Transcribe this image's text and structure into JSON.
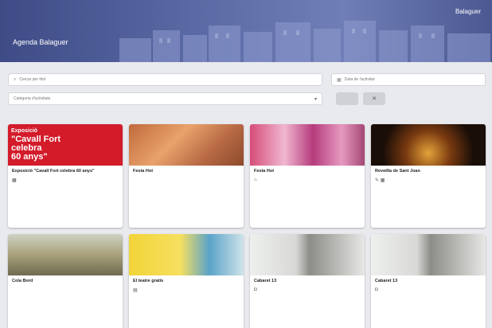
{
  "header": {
    "app_title": "Agenda Balaguer",
    "brand": "Balaguer",
    "nav": [
      "",
      "",
      "",
      "",
      "",
      ""
    ]
  },
  "filters": {
    "search_placeholder": "Cercar per títol",
    "date_placeholder": "Data de l'activitat",
    "category_placeholder": "Categoria d'activitats",
    "btn_a": "",
    "btn_b": "✕"
  },
  "cards": [
    {
      "title": "Exposició \"Cavall Fort celebra 60 anys\"",
      "lines": [
        "",
        "",
        "",
        ""
      ],
      "footer_icon": "grid-icon",
      "poster": {
        "l1": "Exposició",
        "l2": "\"Cavall Fort",
        "l3": "celebra",
        "l4": "60 anys\""
      }
    },
    {
      "title": "Festa Hot",
      "lines": [
        "",
        "",
        ""
      ],
      "footer_icon": ""
    },
    {
      "title": "Festa Hot",
      "lines": [
        "",
        "",
        ""
      ],
      "footer_icon": "cap-icon"
    },
    {
      "title": "Revetlla de Sant Joan",
      "lines": [
        "",
        "",
        ""
      ],
      "footer_icon": "pencil-icon"
    },
    {
      "title": "Cola Bord",
      "lines": [
        "",
        "",
        "",
        ""
      ],
      "footer_icon": ""
    },
    {
      "title": "El teatre gratis",
      "lines": [
        "",
        "",
        ""
      ],
      "footer_icon": "clap-icon"
    },
    {
      "title": "Cabaret 13",
      "lines": [
        "",
        "",
        ""
      ],
      "footer_icon": "shield-icon"
    },
    {
      "title": "Cabaret 13",
      "lines": [
        "",
        "",
        ""
      ],
      "footer_icon": "shield-icon"
    }
  ]
}
